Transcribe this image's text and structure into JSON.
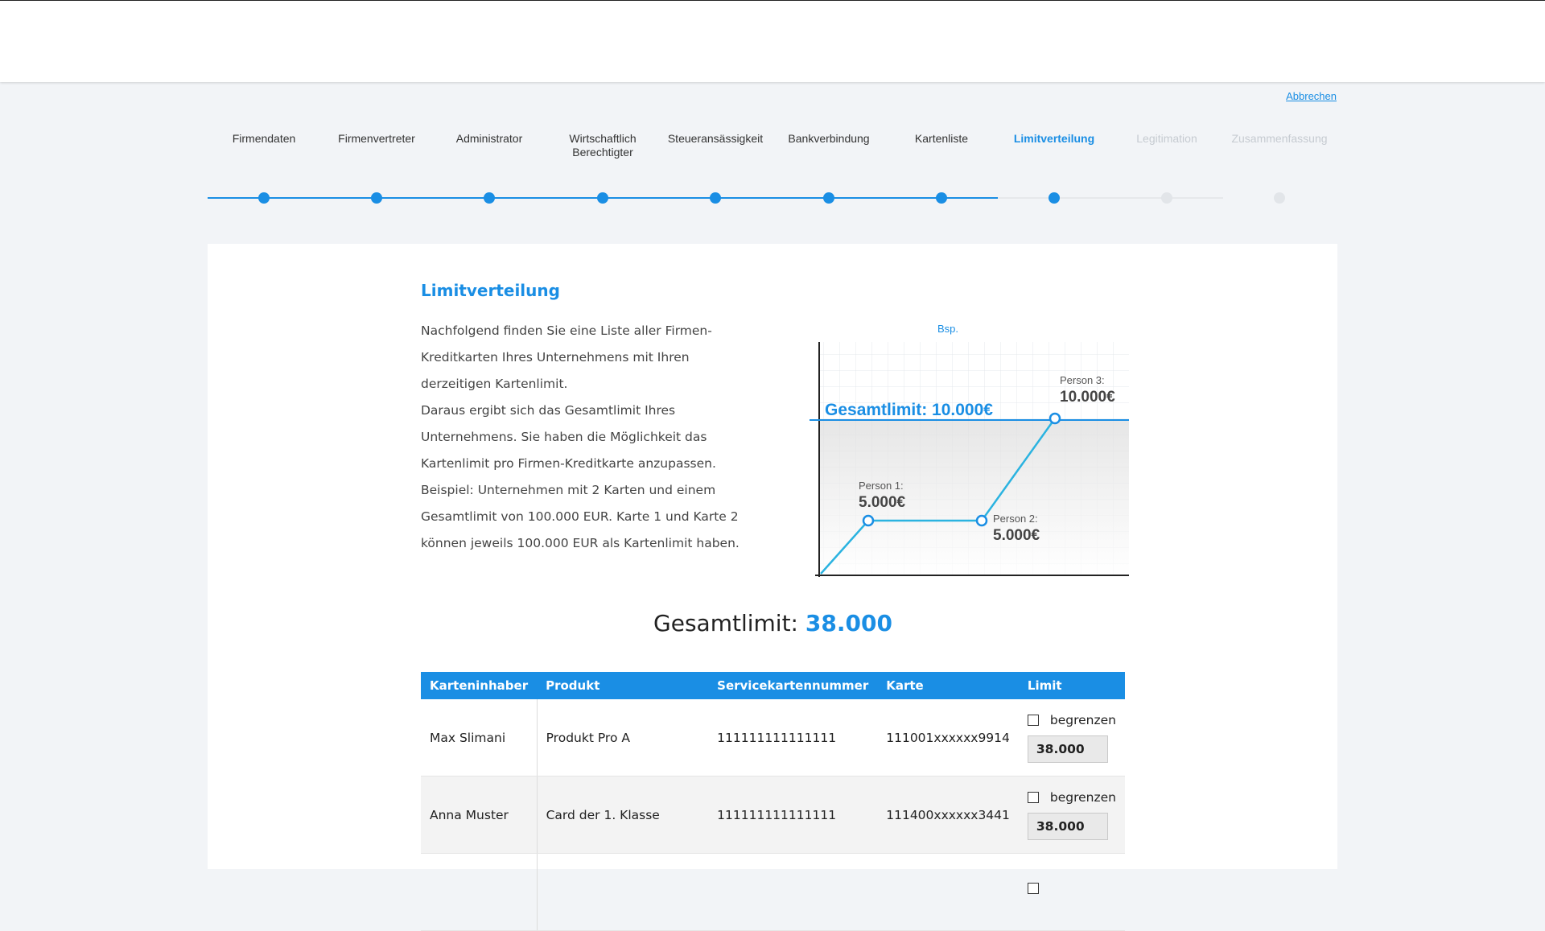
{
  "header": {
    "cancel_label": "Abbrechen"
  },
  "steps": [
    {
      "label": "Firmendaten",
      "state": "done"
    },
    {
      "label": "Firmenvertreter",
      "state": "done"
    },
    {
      "label": "Administrator",
      "state": "done"
    },
    {
      "label": "Wirtschaftlich Berechtigter",
      "state": "done"
    },
    {
      "label": "Steueransässigkeit",
      "state": "done"
    },
    {
      "label": "Bankverbindung",
      "state": "done"
    },
    {
      "label": "Kartenliste",
      "state": "done"
    },
    {
      "label": "Limitverteilung",
      "state": "active"
    },
    {
      "label": "Legitimation",
      "state": "inactive"
    },
    {
      "label": "Zusammenfassung",
      "state": "inactive"
    }
  ],
  "section": {
    "title": "Limitverteilung",
    "paragraph_1": "Nachfolgend finden Sie eine Liste aller Firmen-Kreditkarten Ihres Unternehmens mit Ihren derzeitigen Kartenlimit.",
    "paragraph_2": "Daraus ergibt sich das Gesamtlimit Ihres Unternehmens. Sie haben die Möglichkeit das Kartenlimit pro Firmen-Kreditkarte anzupassen.",
    "paragraph_3": "Beispiel: Unternehmen mit 2 Karten und einem Gesamtlimit von 100.000 EUR. Karte 1 und Karte 2 können jeweils 100.000 EUR als Kartenlimit haben."
  },
  "example_chart": {
    "caption": "Bsp.",
    "total_label": "Gesamtlimit: 10.000€",
    "points": [
      {
        "name": "Person 1:",
        "value": "5.000€"
      },
      {
        "name": "Person 2:",
        "value": "5.000€"
      },
      {
        "name": "Person 3:",
        "value": "10.000€"
      }
    ]
  },
  "total": {
    "label": "Gesamtlimit:",
    "value": "38.000"
  },
  "table": {
    "headers": [
      "Karteninhaber",
      "Produkt",
      "Servicekartennummer",
      "Karte",
      "Limit"
    ],
    "checkbox_label": "begrenzen",
    "rows": [
      {
        "holder": "Max Slimani",
        "product": "Produkt Pro A",
        "service_no": "111111111111111",
        "card": "111001xxxxxx9914",
        "limit": "38.000"
      },
      {
        "holder": "Anna Muster",
        "product": "Card der 1. Klasse",
        "service_no": "111111111111111",
        "card": "111400xxxxxx3441",
        "limit": "38.000"
      }
    ]
  },
  "colors": {
    "accent": "#1a8ee4",
    "chart_line": "#2bb3e0"
  }
}
